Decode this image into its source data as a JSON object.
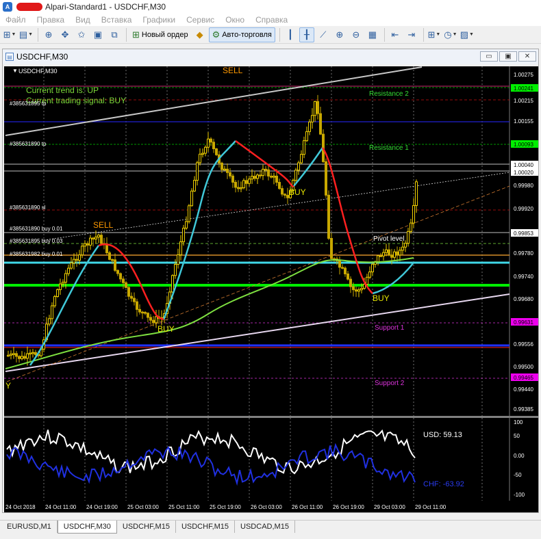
{
  "window": {
    "title": "Alpari-Standard1 - USDCHF,M30"
  },
  "menu": [
    "Файл",
    "Правка",
    "Вид",
    "Вставка",
    "Графики",
    "Сервис",
    "Окно",
    "Справка"
  ],
  "toolbar": {
    "new_order_label": "Новый ордер",
    "auto_trading_label": "Авто-торговля"
  },
  "chart_window": {
    "title": "USDCHF,M30",
    "controls": [
      "▭",
      "▣",
      "✕"
    ]
  },
  "chart": {
    "symbol_label": "USDCHF,M30",
    "trend_text": "Current trend is: UP",
    "signal_text": "Current trading signal: BUY",
    "pivot_label": "Pivot level",
    "resistance2_label": "Resistance 2",
    "resistance1_label": "Resistance 1",
    "support1_label": "Support 1",
    "support2_label": "Support 2",
    "signals": [
      {
        "text": "SELL",
        "color": "#ff9900"
      },
      {
        "text": "SELL",
        "color": "#ff9900"
      },
      {
        "text": "BUY",
        "color": "#e6e600"
      },
      {
        "text": "BUY",
        "color": "#e6e600"
      },
      {
        "text": "BUY",
        "color": "#e6e600"
      },
      {
        "text": "Y",
        "color": "#e6e600"
      }
    ],
    "order_labels": [
      "#385631895 tp",
      "#385631890 tp",
      "#385631890 sl",
      "#385631890 buy 0.01",
      "#385631895 buy 0.03",
      "#385631982 buy 0.01"
    ],
    "price_ticks": [
      "1.00275",
      "1.00215",
      "1.00155",
      "0.99980",
      "0.99920",
      "0.99780",
      "0.99740",
      "0.99680",
      "0.99556",
      "0.99500",
      "0.99440",
      "0.99385"
    ],
    "price_badges": [
      {
        "text": "1.00241",
        "bg": "#00ee00",
        "fg": "#000000"
      },
      {
        "text": "1.00093",
        "bg": "#00ee00",
        "fg": "#000000"
      },
      {
        "text": "1.00040",
        "bg": "#ffffff",
        "fg": "#000000"
      },
      {
        "text": "1.00020",
        "bg": "#ffffff",
        "fg": "#000000"
      },
      {
        "text": "0.99853",
        "bg": "#ffffff",
        "fg": "#000000"
      },
      {
        "text": "0.99631",
        "bg": "#ee00ee",
        "fg": "#000000"
      },
      {
        "text": "0.99465",
        "bg": "#ee00ee",
        "fg": "#000000"
      }
    ],
    "time_labels": [
      "24 Oct 2018",
      "24 Oct 11:00",
      "24 Oct 19:00",
      "25 Oct 03:00",
      "25 Oct 11:00",
      "25 Oct 19:00",
      "26 Oct 03:00",
      "26 Oct 11:00",
      "26 Oct 19:00",
      "29 Oct 03:00",
      "29 Oct 11:00"
    ],
    "osc_ticks": [
      "100",
      "50",
      "0.00",
      "-50",
      "-100"
    ],
    "usd_label": "USD: 59.13",
    "chf_label": "CHF: -63.92",
    "colors": {
      "background": "#000000",
      "bull": "#f0d000",
      "bear": "#c8a800",
      "ma_fast": "#ff2020",
      "ma_fast_up": "#40c8d8",
      "ma_slow": "#7ee040",
      "usd_line": "#ffffff",
      "chf_line": "#2030e0"
    }
  },
  "tabs": [
    {
      "label": "EURUSD,M1",
      "active": false
    },
    {
      "label": "USDCHF,M30",
      "active": true
    },
    {
      "label": "USDCHF,M15",
      "active": false
    },
    {
      "label": "USDCHF,M15",
      "active": false
    },
    {
      "label": "USDCAD,M15",
      "active": false
    }
  ]
}
